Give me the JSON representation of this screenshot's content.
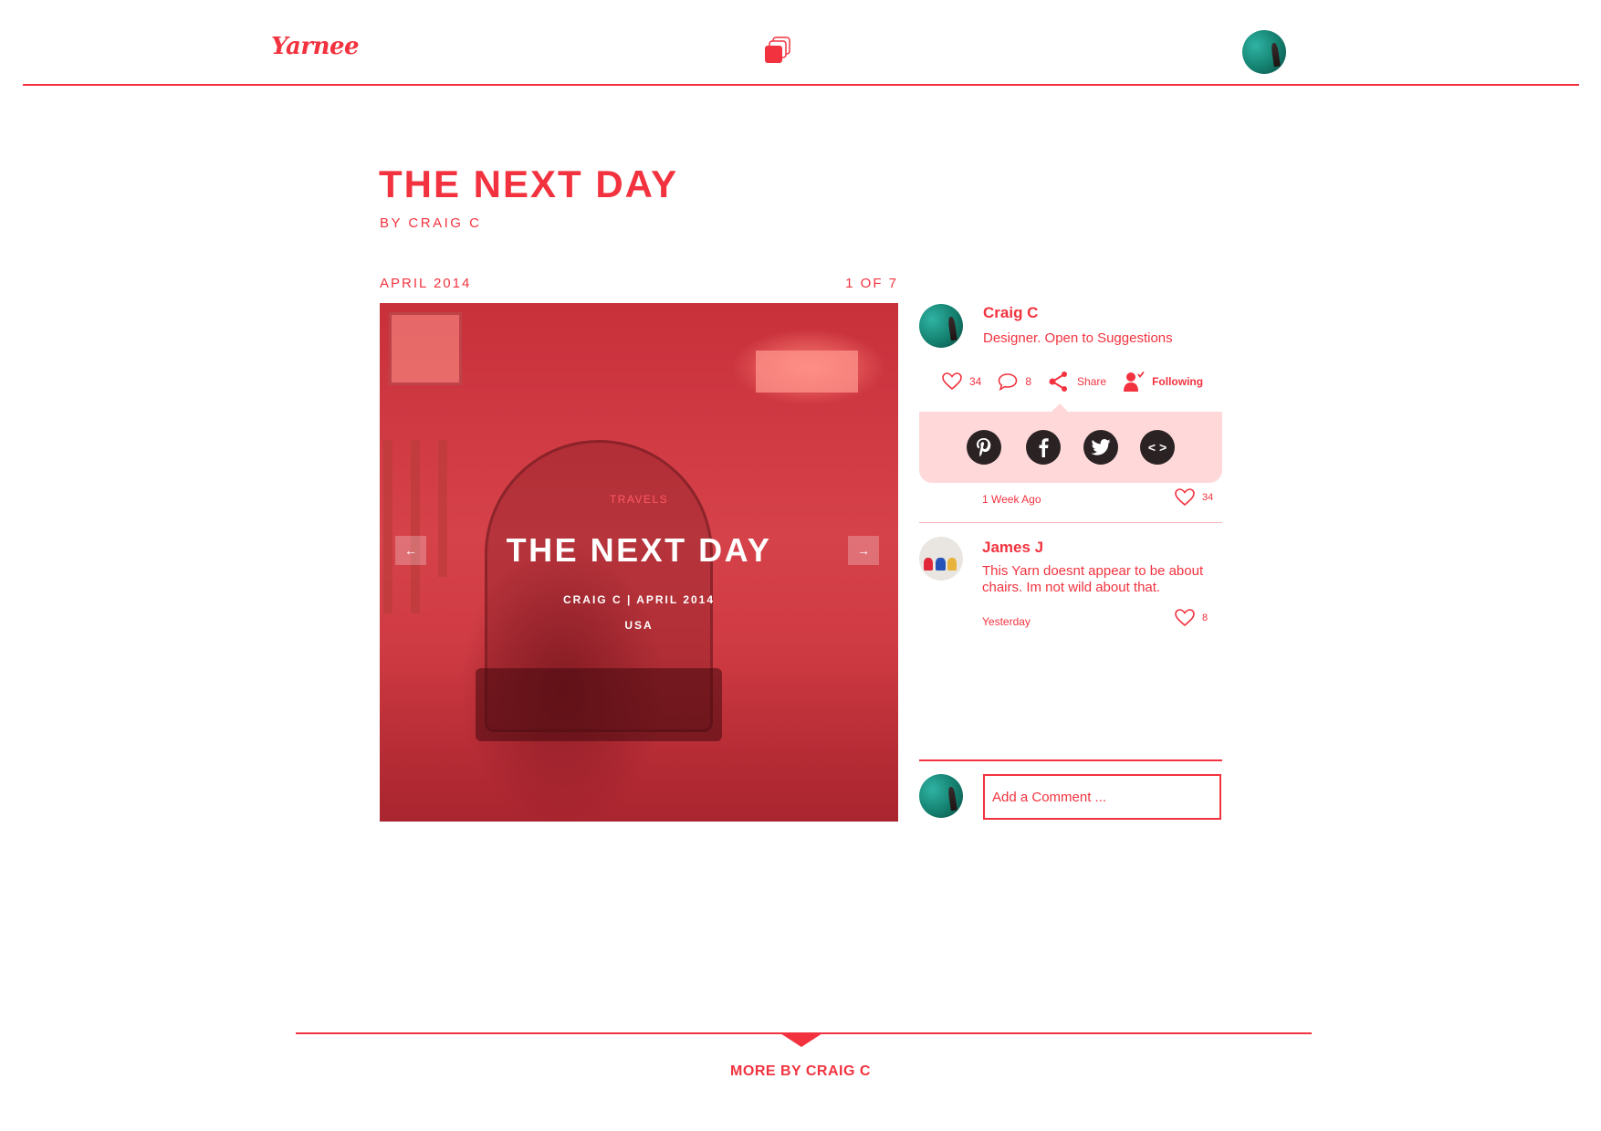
{
  "header": {
    "logo": "Yarnee",
    "center_icon": "stack-icon",
    "avatar": "user-avatar"
  },
  "post": {
    "title": "THE NEXT DAY",
    "byline": "BY CRAIG C",
    "date": "APRIL 2014",
    "counter": "1 OF 7"
  },
  "hero": {
    "category": "TRAVELS",
    "title": "THE NEXT DAY",
    "meta": "CRAIG C | APRIL 2014",
    "location": "USA",
    "prev_label": "←",
    "next_label": "→"
  },
  "author": {
    "name": "Craig C",
    "bio": "Designer. Open to Suggestions"
  },
  "actions": {
    "likes": "34",
    "comments": "8",
    "share_label": "Share",
    "follow_label": "Following"
  },
  "share_targets": [
    {
      "icon": "pinterest-icon",
      "glyph": "P"
    },
    {
      "icon": "facebook-icon",
      "glyph": "f"
    },
    {
      "icon": "twitter-icon",
      "glyph": "t"
    },
    {
      "icon": "embed-icon",
      "glyph": "< >"
    }
  ],
  "post_meta": {
    "time": "1 Week Ago",
    "likes": "34"
  },
  "comments": [
    {
      "name": "James J",
      "text": "This Yarn doesnt appear to be about chairs. Im not wild about that.",
      "time": "Yesterday",
      "likes": "8"
    }
  ],
  "comment_form": {
    "placeholder": "Add a Comment ..."
  },
  "footer": {
    "more_label": "MORE BY CRAIG C"
  },
  "colors": {
    "accent": "#f2333f",
    "share_panel": "#ffd9da",
    "social_button": "#2b2224"
  }
}
